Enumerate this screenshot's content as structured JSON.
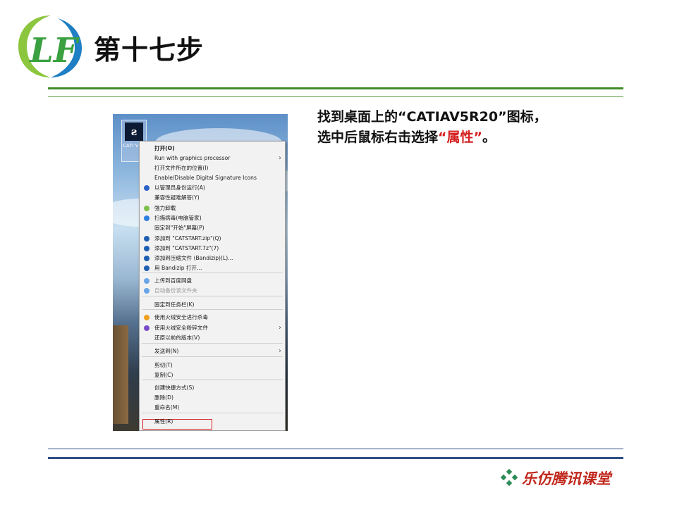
{
  "header": {
    "logo_text": "LF",
    "title": "第十七步"
  },
  "instruction": {
    "line1": "找到桌面上的“CATIAV5R20”图标，",
    "line2_prefix": "选中后鼠标右击选择",
    "line2_highlight": "“属性”",
    "line2_suffix": "。"
  },
  "desktop": {
    "icon_glyph": "ƨ",
    "icon_label": "CATI V5R"
  },
  "menu": {
    "items": [
      {
        "label": "打开(O)",
        "bold": true
      },
      {
        "label": "Run with graphics processor",
        "submenu": true
      },
      {
        "label": "打开文件所在的位置(I)"
      },
      {
        "label": "Enable/Disable Digital Signature Icons"
      },
      {
        "label": "以管理员身份运行(A)",
        "icon": "shield-icon"
      },
      {
        "label": "兼容性疑难解答(Y)"
      },
      {
        "label": "强力卸载",
        "icon": "uninstall-icon"
      },
      {
        "label": "扫描病毒(电脑管家)",
        "icon": "virus-scan-icon"
      },
      {
        "label": "固定到\"开始\"屏幕(P)"
      },
      {
        "label": "添加到 \"CATSTART.zip\"(Q)",
        "icon": "bandizip-icon"
      },
      {
        "label": "添加到 \"CATSTART.7z\"(7)",
        "icon": "bandizip-icon"
      },
      {
        "label": "添加到压缩文件 (Bandizip)(L)...",
        "icon": "bandizip-icon"
      },
      {
        "label": "用 Bandizip 打开...",
        "icon": "bandizip-icon"
      },
      {
        "label": "上传到百度网盘",
        "icon": "cloud-icon"
      },
      {
        "label": "自动备份该文件夹",
        "icon": "cloud-icon",
        "disabled": true
      },
      {
        "label": "固定到任务栏(K)"
      },
      {
        "label": "使用火绒安全进行杀毒",
        "icon": "huorong-icon"
      },
      {
        "label": "使用火绒安全粉碎文件",
        "icon": "shred-icon",
        "submenu": true
      },
      {
        "label": "还原以前的版本(V)"
      },
      {
        "label": "发送到(N)",
        "submenu": true
      },
      {
        "label": "剪切(T)"
      },
      {
        "label": "复制(C)"
      },
      {
        "label": "创建快捷方式(S)"
      },
      {
        "label": "删除(D)"
      },
      {
        "label": "重命名(M)"
      },
      {
        "label": "属性(R)"
      }
    ]
  },
  "footer": {
    "brand": "乐仿腾讯课堂"
  },
  "colors": {
    "green_rule": "#3f8c2a",
    "blue_rule": "#2f4f84",
    "highlight_red": "#d62424",
    "brand_red": "#c0281c"
  }
}
